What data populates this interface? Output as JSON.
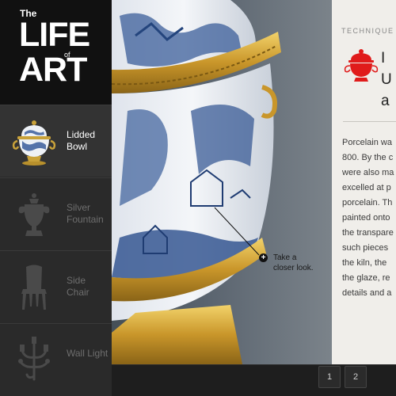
{
  "logo": {
    "the": "The",
    "life": "LIFE",
    "of": "of",
    "art": "ART"
  },
  "sidebar": {
    "items": [
      {
        "label": "Lidded Bowl",
        "active": true,
        "icon": "lidded-bowl-thumb"
      },
      {
        "label": "Silver Fountain",
        "active": false,
        "icon": "silver-fountain-icon"
      },
      {
        "label": "Side Chair",
        "active": false,
        "icon": "side-chair-icon"
      },
      {
        "label": "Wall Light",
        "active": false,
        "icon": "wall-light-icon"
      }
    ]
  },
  "callout": {
    "plus": "+",
    "text_line1": "Take a",
    "text_line2": "closer look."
  },
  "panel": {
    "kicker": "TECHNIQUE",
    "title_lines": [
      "I",
      "U",
      "a"
    ],
    "accent_color": "#e01b1b",
    "body_lines": [
      "Porcelain wa",
      "800. By the c",
      "were also ma",
      "excelled at p",
      "porcelain. Th",
      "painted onto",
      "the transpare",
      "such pieces",
      "the kiln, the",
      "the glaze, re",
      "details and a"
    ]
  },
  "pagination": {
    "pages": [
      "1",
      "2"
    ]
  }
}
